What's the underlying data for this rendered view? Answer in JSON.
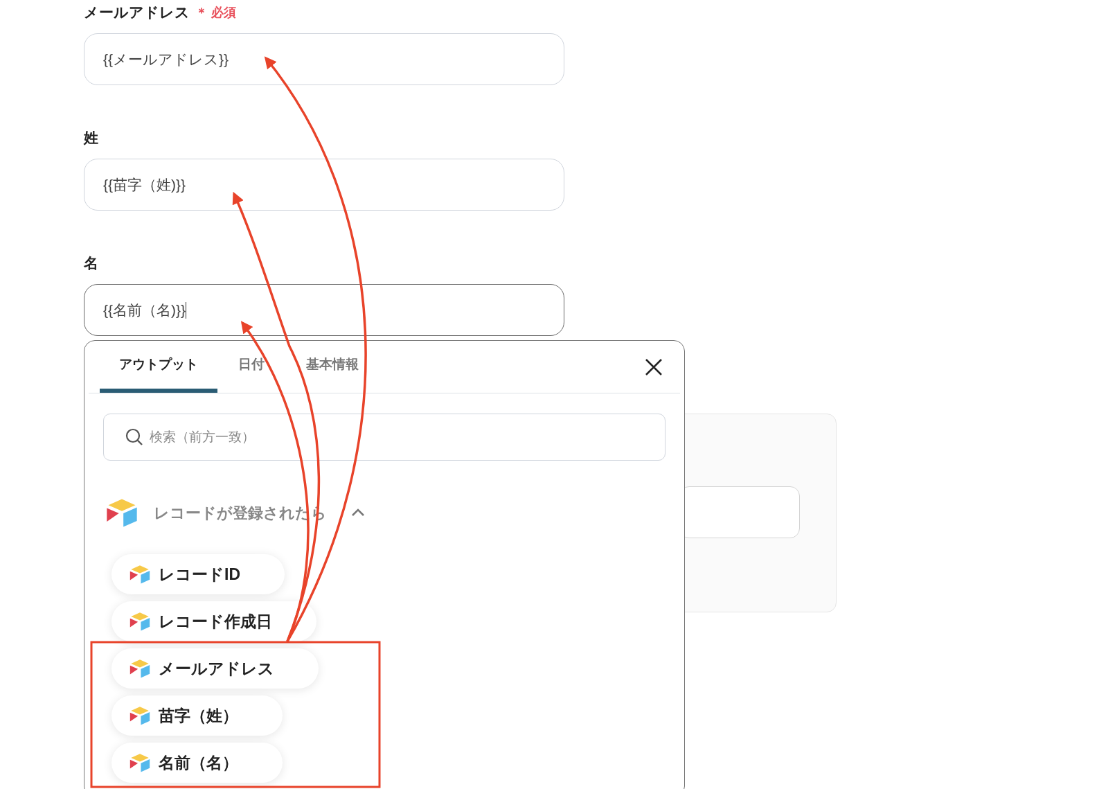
{
  "fields": [
    {
      "label": "メールアドレス",
      "required": "＊ 必須",
      "value": "{{メールアドレス}}",
      "focused": false
    },
    {
      "label": "姓",
      "value": "{{苗字（姓)}}",
      "focused": false
    },
    {
      "label": "名",
      "value": "{{名前（名)}}",
      "focused": true
    }
  ],
  "popup": {
    "tabs": [
      {
        "label": "アウトプット",
        "selected": true
      },
      {
        "label": "日付",
        "selected": false
      },
      {
        "label": "基本情報",
        "selected": false
      }
    ],
    "search": {
      "placeholder": "検索（前方一致）"
    },
    "group": {
      "title": "レコードが登録されたら",
      "expanded": true,
      "items": [
        {
          "label": "レコードID"
        },
        {
          "label": "レコード作成日"
        },
        {
          "label": "メールアドレス"
        },
        {
          "label": "苗字（姓）"
        },
        {
          "label": "名前（名）"
        }
      ]
    }
  }
}
